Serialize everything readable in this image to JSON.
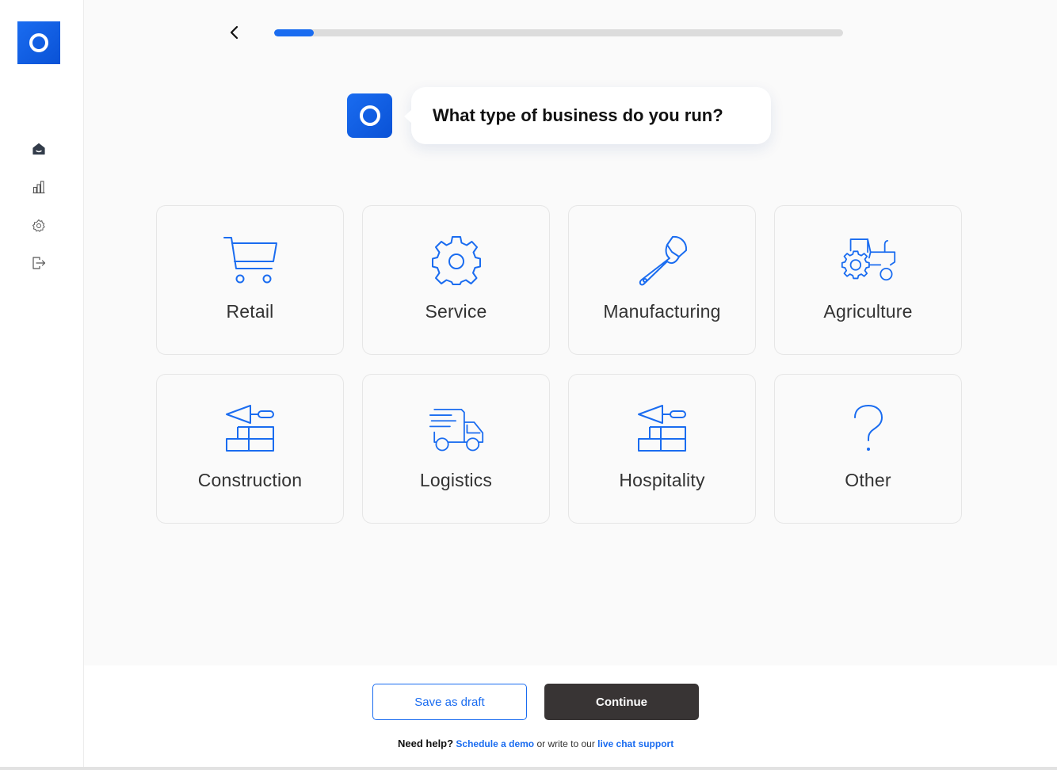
{
  "app": {
    "logo_icon": "brand-ring-icon",
    "accent": "#1a6cf0"
  },
  "sidebar": {
    "items": [
      {
        "name": "home",
        "icon": "home-icon"
      },
      {
        "name": "analytics",
        "icon": "bar-chart-icon"
      },
      {
        "name": "settings",
        "icon": "gear-icon"
      },
      {
        "name": "logout",
        "icon": "logout-icon"
      }
    ]
  },
  "header": {
    "back_icon": "chevron-left-icon",
    "progress": 0.07
  },
  "prompt": {
    "question": "What type of business do you run?"
  },
  "options": [
    {
      "label": "Retail",
      "icon": "shopping-cart-icon"
    },
    {
      "label": "Service",
      "icon": "gear-icon"
    },
    {
      "label": "Manufacturing",
      "icon": "wrench-icon"
    },
    {
      "label": "Agriculture",
      "icon": "tractor-icon"
    },
    {
      "label": "Construction",
      "icon": "trowel-bricks-icon"
    },
    {
      "label": "Logistics",
      "icon": "delivery-truck-icon"
    },
    {
      "label": "Hospitality",
      "icon": "trowel-bricks-icon"
    },
    {
      "label": "Other",
      "icon": "question-mark-icon"
    }
  ],
  "footer": {
    "save_draft_label": "Save as draft",
    "continue_label": "Continue",
    "help_prefix": "Need help?",
    "schedule_link": "Schedule a demo",
    "help_middle": "or write to our",
    "support_link": "live chat support"
  }
}
